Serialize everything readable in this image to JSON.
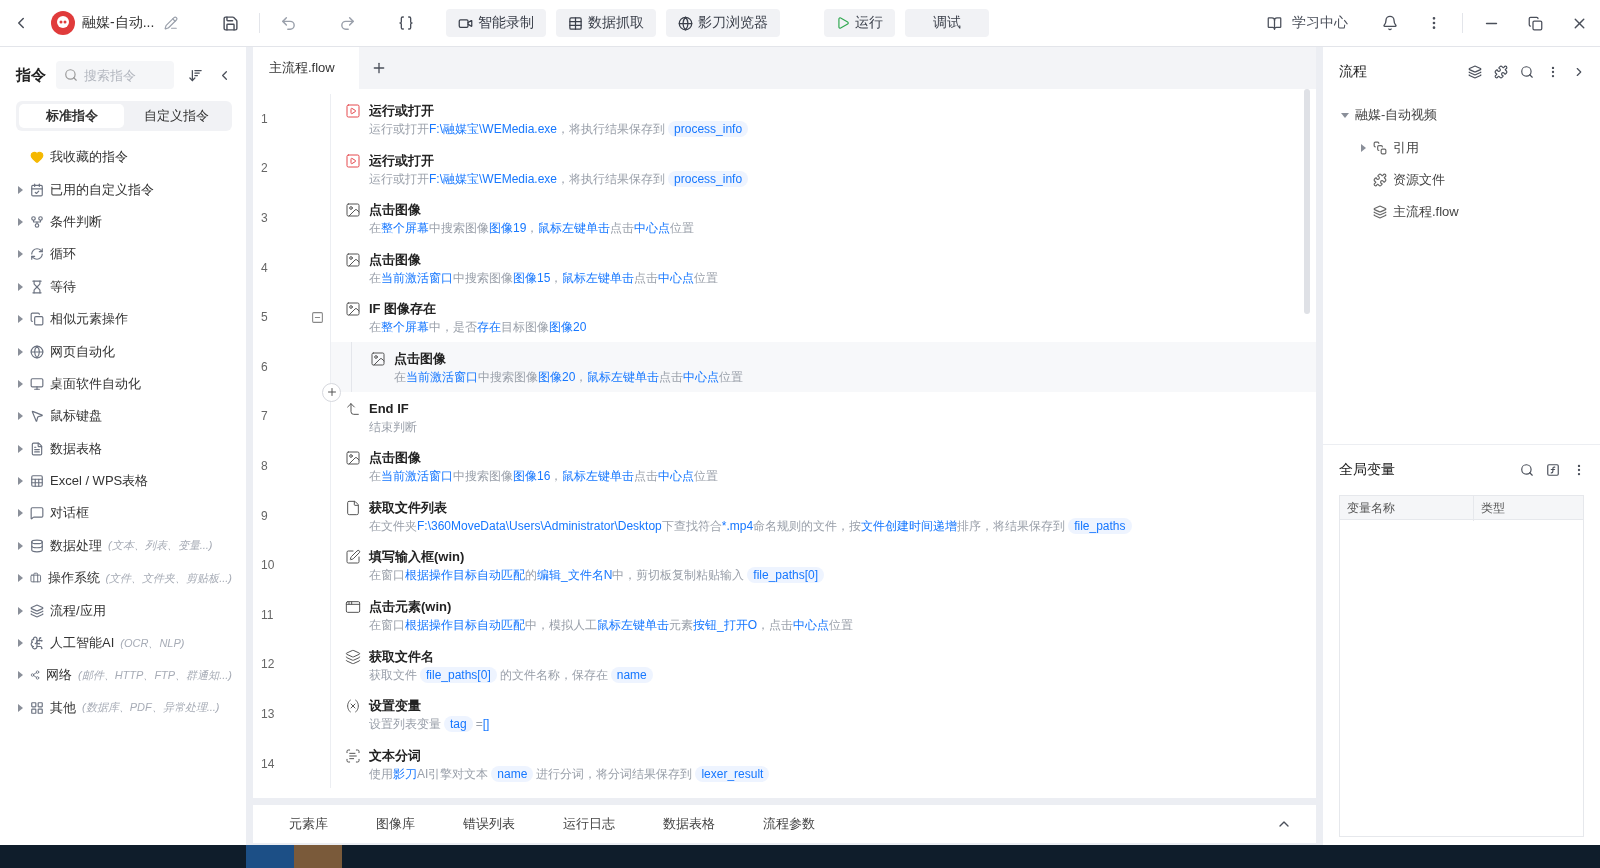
{
  "window": {
    "title": "融媒-自动...",
    "toolbar": [
      "智能录制",
      "数据抓取",
      "影刀浏览器"
    ],
    "run": "运行",
    "debug": "调试",
    "learn": "学习中心"
  },
  "sidebar": {
    "title": "指令",
    "search_placeholder": "搜索指令",
    "tabs": [
      {
        "label": "标准指令",
        "selected": true
      },
      {
        "label": "自定义指令",
        "selected": false
      }
    ],
    "items": [
      {
        "kind": "favorite",
        "label": "我收藏的指令",
        "expandable": false
      },
      {
        "kind": "custom",
        "label": "已用的自定义指令",
        "expandable": true
      },
      {
        "kind": "branch",
        "label": "条件判断",
        "expandable": true
      },
      {
        "kind": "loop",
        "label": "循环",
        "expandable": true
      },
      {
        "kind": "wait",
        "label": "等待",
        "expandable": true
      },
      {
        "kind": "similar",
        "label": "相似元素操作",
        "expandable": true
      },
      {
        "kind": "web",
        "label": "网页自动化",
        "expandable": true
      },
      {
        "kind": "desktop",
        "label": "桌面软件自动化",
        "expandable": true
      },
      {
        "kind": "mouse",
        "label": "鼠标键盘",
        "expandable": true
      },
      {
        "kind": "table",
        "label": "数据表格",
        "expandable": true
      },
      {
        "kind": "excel",
        "label": "Excel / WPS表格",
        "expandable": true
      },
      {
        "kind": "dialog",
        "label": "对话框",
        "expandable": true
      },
      {
        "kind": "data",
        "label": "数据处理",
        "hint": "(文本、列表、变量...)",
        "expandable": true
      },
      {
        "kind": "os",
        "label": "操作系统",
        "hint": "(文件、文件夹、剪贴板...)",
        "expandable": true
      },
      {
        "kind": "flow",
        "label": "流程/应用",
        "expandable": true
      },
      {
        "kind": "ai",
        "label": "人工智能AI",
        "hint": "(OCR、NLP)",
        "expandable": true
      },
      {
        "kind": "network",
        "label": "网络",
        "hint": "(邮件、HTTP、FTP、群通知...)",
        "expandable": true
      },
      {
        "kind": "other",
        "label": "其他",
        "hint": "(数据库、PDF、异常处理...)",
        "expandable": true
      }
    ]
  },
  "editor": {
    "tabs": [
      {
        "label": "主流程.flow",
        "selected": true
      }
    ],
    "steps": [
      {
        "line": "1",
        "kind": "run",
        "title": "运行或打开",
        "selected": false,
        "desc": [
          {
            "kind": "plain",
            "text": "运行或打开"
          },
          {
            "kind": "link",
            "text": "F:\\融媒宝\\WEMedia.exe"
          },
          {
            "kind": "plain",
            "text": "，将执行结果保存到"
          },
          {
            "kind": "var",
            "text": "process_info"
          }
        ]
      },
      {
        "line": "2",
        "kind": "run",
        "title": "运行或打开",
        "selected": false,
        "desc": [
          {
            "kind": "plain",
            "text": "运行或打开"
          },
          {
            "kind": "link",
            "text": "F:\\融媒宝\\WEMedia.exe"
          },
          {
            "kind": "plain",
            "text": "，将执行结果保存到"
          },
          {
            "kind": "var",
            "text": "process_info"
          }
        ]
      },
      {
        "line": "3",
        "kind": "image",
        "title": "点击图像",
        "selected": false,
        "desc": [
          {
            "kind": "plain",
            "text": "在"
          },
          {
            "kind": "link",
            "text": "整个屏幕"
          },
          {
            "kind": "plain",
            "text": "中搜索图像"
          },
          {
            "kind": "link",
            "text": "图像19"
          },
          {
            "kind": "plain",
            "text": "，"
          },
          {
            "kind": "link",
            "text": "鼠标左键单击"
          },
          {
            "kind": "plain",
            "text": "点击"
          },
          {
            "kind": "link",
            "text": "中心点"
          },
          {
            "kind": "plain",
            "text": "位置"
          }
        ]
      },
      {
        "line": "4",
        "kind": "image",
        "title": "点击图像",
        "selected": false,
        "desc": [
          {
            "kind": "plain",
            "text": "在"
          },
          {
            "kind": "link",
            "text": "当前激活窗口"
          },
          {
            "kind": "plain",
            "text": "中搜索图像"
          },
          {
            "kind": "link",
            "text": "图像15"
          },
          {
            "kind": "plain",
            "text": "，"
          },
          {
            "kind": "link",
            "text": "鼠标左键单击"
          },
          {
            "kind": "plain",
            "text": "点击"
          },
          {
            "kind": "link",
            "text": "中心点"
          },
          {
            "kind": "plain",
            "text": "位置"
          }
        ]
      },
      {
        "line": "5",
        "kind": "if",
        "title": "IF 图像存在",
        "selected": false,
        "expanded": true,
        "desc": [
          {
            "kind": "plain",
            "text": "在"
          },
          {
            "kind": "link",
            "text": "整个屏幕"
          },
          {
            "kind": "plain",
            "text": "中，是否"
          },
          {
            "kind": "link",
            "text": "存在"
          },
          {
            "kind": "plain",
            "text": "目标图像"
          },
          {
            "kind": "link",
            "text": "图像20"
          }
        ],
        "children": [
          {
            "line": "6",
            "kind": "image",
            "title": "点击图像",
            "selected": true,
            "desc": [
              {
                "kind": "plain",
                "text": "在"
              },
              {
                "kind": "link",
                "text": "当前激活窗口"
              },
              {
                "kind": "plain",
                "text": "中搜索图像"
              },
              {
                "kind": "link",
                "text": "图像20"
              },
              {
                "kind": "plain",
                "text": "，"
              },
              {
                "kind": "link",
                "text": "鼠标左键单击"
              },
              {
                "kind": "plain",
                "text": "点击"
              },
              {
                "kind": "link",
                "text": "中心点"
              },
              {
                "kind": "plain",
                "text": "位置"
              }
            ]
          }
        ]
      },
      {
        "line": "7",
        "kind": "endif",
        "title": "End IF",
        "selected": false,
        "desc": [
          {
            "kind": "plain",
            "text": "结束判断"
          }
        ]
      },
      {
        "line": "8",
        "kind": "image",
        "title": "点击图像",
        "selected": false,
        "desc": [
          {
            "kind": "plain",
            "text": "在"
          },
          {
            "kind": "link",
            "text": "当前激活窗口"
          },
          {
            "kind": "plain",
            "text": "中搜索图像"
          },
          {
            "kind": "link",
            "text": "图像16"
          },
          {
            "kind": "plain",
            "text": "，"
          },
          {
            "kind": "link",
            "text": "鼠标左键单击"
          },
          {
            "kind": "plain",
            "text": "点击"
          },
          {
            "kind": "link",
            "text": "中心点"
          },
          {
            "kind": "plain",
            "text": "位置"
          }
        ]
      },
      {
        "line": "9",
        "kind": "file",
        "title": "获取文件列表",
        "selected": false,
        "desc": [
          {
            "kind": "plain",
            "text": "在文件夹"
          },
          {
            "kind": "link",
            "text": "F:\\360MoveData\\Users\\Administrator\\Desktop"
          },
          {
            "kind": "plain",
            "text": "下查找符合"
          },
          {
            "kind": "link",
            "text": "*.mp4"
          },
          {
            "kind": "plain",
            "text": "命名规则的文件，按"
          },
          {
            "kind": "link",
            "text": "文件创建时间递增"
          },
          {
            "kind": "plain",
            "text": "排序，将结果保存到"
          },
          {
            "kind": "var",
            "text": "file_paths"
          }
        ]
      },
      {
        "line": "10",
        "kind": "input",
        "title": "填写输入框(win)",
        "selected": false,
        "desc": [
          {
            "kind": "plain",
            "text": "在窗口"
          },
          {
            "kind": "link",
            "text": "根据操作目标自动匹配"
          },
          {
            "kind": "plain",
            "text": "的"
          },
          {
            "kind": "link",
            "text": "编辑_文件名N"
          },
          {
            "kind": "plain",
            "text": "中，剪切板复制粘贴输入"
          },
          {
            "kind": "var",
            "text": "file_paths[0]"
          }
        ]
      },
      {
        "line": "11",
        "kind": "element",
        "title": "点击元素(win)",
        "selected": false,
        "desc": [
          {
            "kind": "plain",
            "text": "在窗口"
          },
          {
            "kind": "link",
            "text": "根据操作目标自动匹配"
          },
          {
            "kind": "plain",
            "text": "中，模拟人工"
          },
          {
            "kind": "link",
            "text": "鼠标左键单击"
          },
          {
            "kind": "plain",
            "text": "元素"
          },
          {
            "kind": "link",
            "text": "按钮_打开O"
          },
          {
            "kind": "plain",
            "text": "，点击"
          },
          {
            "kind": "link",
            "text": "中心点"
          },
          {
            "kind": "plain",
            "text": "位置"
          }
        ]
      },
      {
        "line": "12",
        "kind": "filename",
        "title": "获取文件名",
        "selected": false,
        "desc": [
          {
            "kind": "plain",
            "text": "获取文件"
          },
          {
            "kind": "var",
            "text": "file_paths[0]"
          },
          {
            "kind": "plain",
            "text": "的文件名称，保存在"
          },
          {
            "kind": "var",
            "text": "name"
          }
        ]
      },
      {
        "line": "13",
        "kind": "variable",
        "title": "设置变量",
        "selected": false,
        "desc": [
          {
            "kind": "plain",
            "text": "设置列表变量"
          },
          {
            "kind": "var",
            "text": "tag"
          },
          {
            "kind": "plain",
            "text": "="
          },
          {
            "kind": "link",
            "text": "[]"
          }
        ]
      },
      {
        "line": "14",
        "kind": "nlp",
        "title": "文本分词",
        "selected": false,
        "desc": [
          {
            "kind": "plain",
            "text": "使用"
          },
          {
            "kind": "link",
            "text": "影刀"
          },
          {
            "kind": "plain",
            "text": "AI引擎对文本"
          },
          {
            "kind": "var",
            "text": "name"
          },
          {
            "kind": "plain",
            "text": "进行分词，将分词结果保存到"
          },
          {
            "kind": "var",
            "text": "lexer_result"
          }
        ]
      }
    ]
  },
  "bottom_tabs": [
    "元素库",
    "图像库",
    "错误列表",
    "运行日志",
    "数据表格",
    "流程参数"
  ],
  "flow_panel": {
    "title": "流程",
    "tree": [
      {
        "label": "融媒-自动视频",
        "expanded": true,
        "children": [
          {
            "kind": "reference",
            "label": "引用",
            "expanded": false
          },
          {
            "kind": "resource",
            "label": "资源文件"
          },
          {
            "kind": "flow",
            "label": "主流程.flow"
          }
        ]
      }
    ]
  },
  "variables_panel": {
    "title": "全局变量",
    "columns": [
      "变量名称",
      "类型"
    ]
  }
}
